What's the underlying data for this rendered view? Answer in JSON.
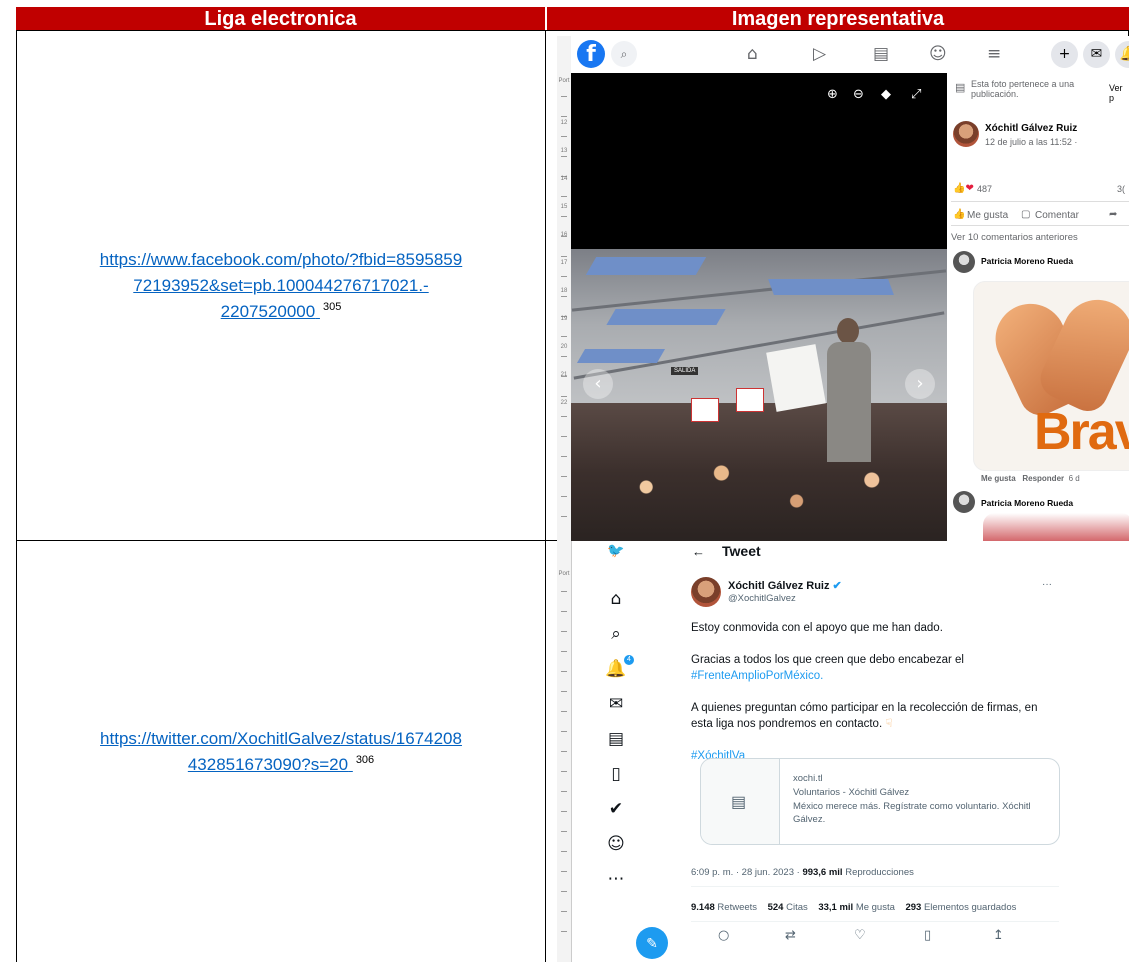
{
  "headers": {
    "col1": "Liga electronica",
    "col2": "Imagen representativa"
  },
  "rows": [
    {
      "link_line1": "https://www.facebook.com/photo/?fbid=8595859",
      "link_line2": "72193952&set=pb.100044276717021.-",
      "link_line3": "2207520000",
      "footnote": "305"
    },
    {
      "link_line1": "https://twitter.com/XochitlGalvez/status/1674208",
      "link_line2": "432851673090?s=20",
      "footnote": "306"
    }
  ],
  "ruler": {
    "label": "Port",
    "numbers": [
      "12",
      "13",
      "14",
      "15",
      "16",
      "17",
      "18",
      "19",
      "20",
      "21",
      "22"
    ]
  },
  "facebook": {
    "logo": "f",
    "post_notice": "Esta foto pertenece a una publicación.",
    "see_post": "Ver p",
    "author": "Xóchitl Gálvez Ruiz",
    "date": "12 de julio a las 11:52 ·",
    "reactions": "487",
    "count_right": "3(",
    "like": "Me gusta",
    "comment": "Comentar",
    "previous_comments": "Ver 10 comentarios anteriores",
    "commenter1": "Patricia Moreno Rueda",
    "sticker_text": "Bravo",
    "comment_like": "Me gusta",
    "comment_reply": "Responder",
    "comment_age": "6 d",
    "commenter2": "Patricia Moreno Rueda",
    "photo_sign": "SALIDA"
  },
  "twitter": {
    "header": "Tweet",
    "name": "Xóchitl Gálvez Ruiz",
    "handle": "@XochitlGalvez",
    "more": "···",
    "text1": "Estoy conmovida con el apoyo que me han dado.",
    "text2": "Gracias a todos los que creen que debo encabezar el",
    "hashtag1": "#FrenteAmplioPorMéxico.",
    "text3a": "A quienes preguntan cómo participar en la recolección de firmas, en",
    "text3b": "esta liga nos pondremos en contacto.",
    "hashtag2": "#XóchitlVa",
    "card_domain": "xochi.tl",
    "card_title": "Voluntarios - Xóchitl Gálvez",
    "card_desc1": "México merece más. Regístrate como voluntario. Xóchitl",
    "card_desc2": "Gálvez.",
    "timestamp": "6:09 p. m. · 28 jun. 2023 ·",
    "views_value": "993,6 mil",
    "views_label": "Reproducciones",
    "retweets_value": "9.148",
    "retweets_label": "Retweets",
    "quotes_value": "524",
    "quotes_label": "Citas",
    "likes_value": "33,1 mil",
    "likes_label": "Me gusta",
    "bookmarks_value": "293",
    "bookmarks_label": "Elementos guardados",
    "notif_badge": "4"
  }
}
